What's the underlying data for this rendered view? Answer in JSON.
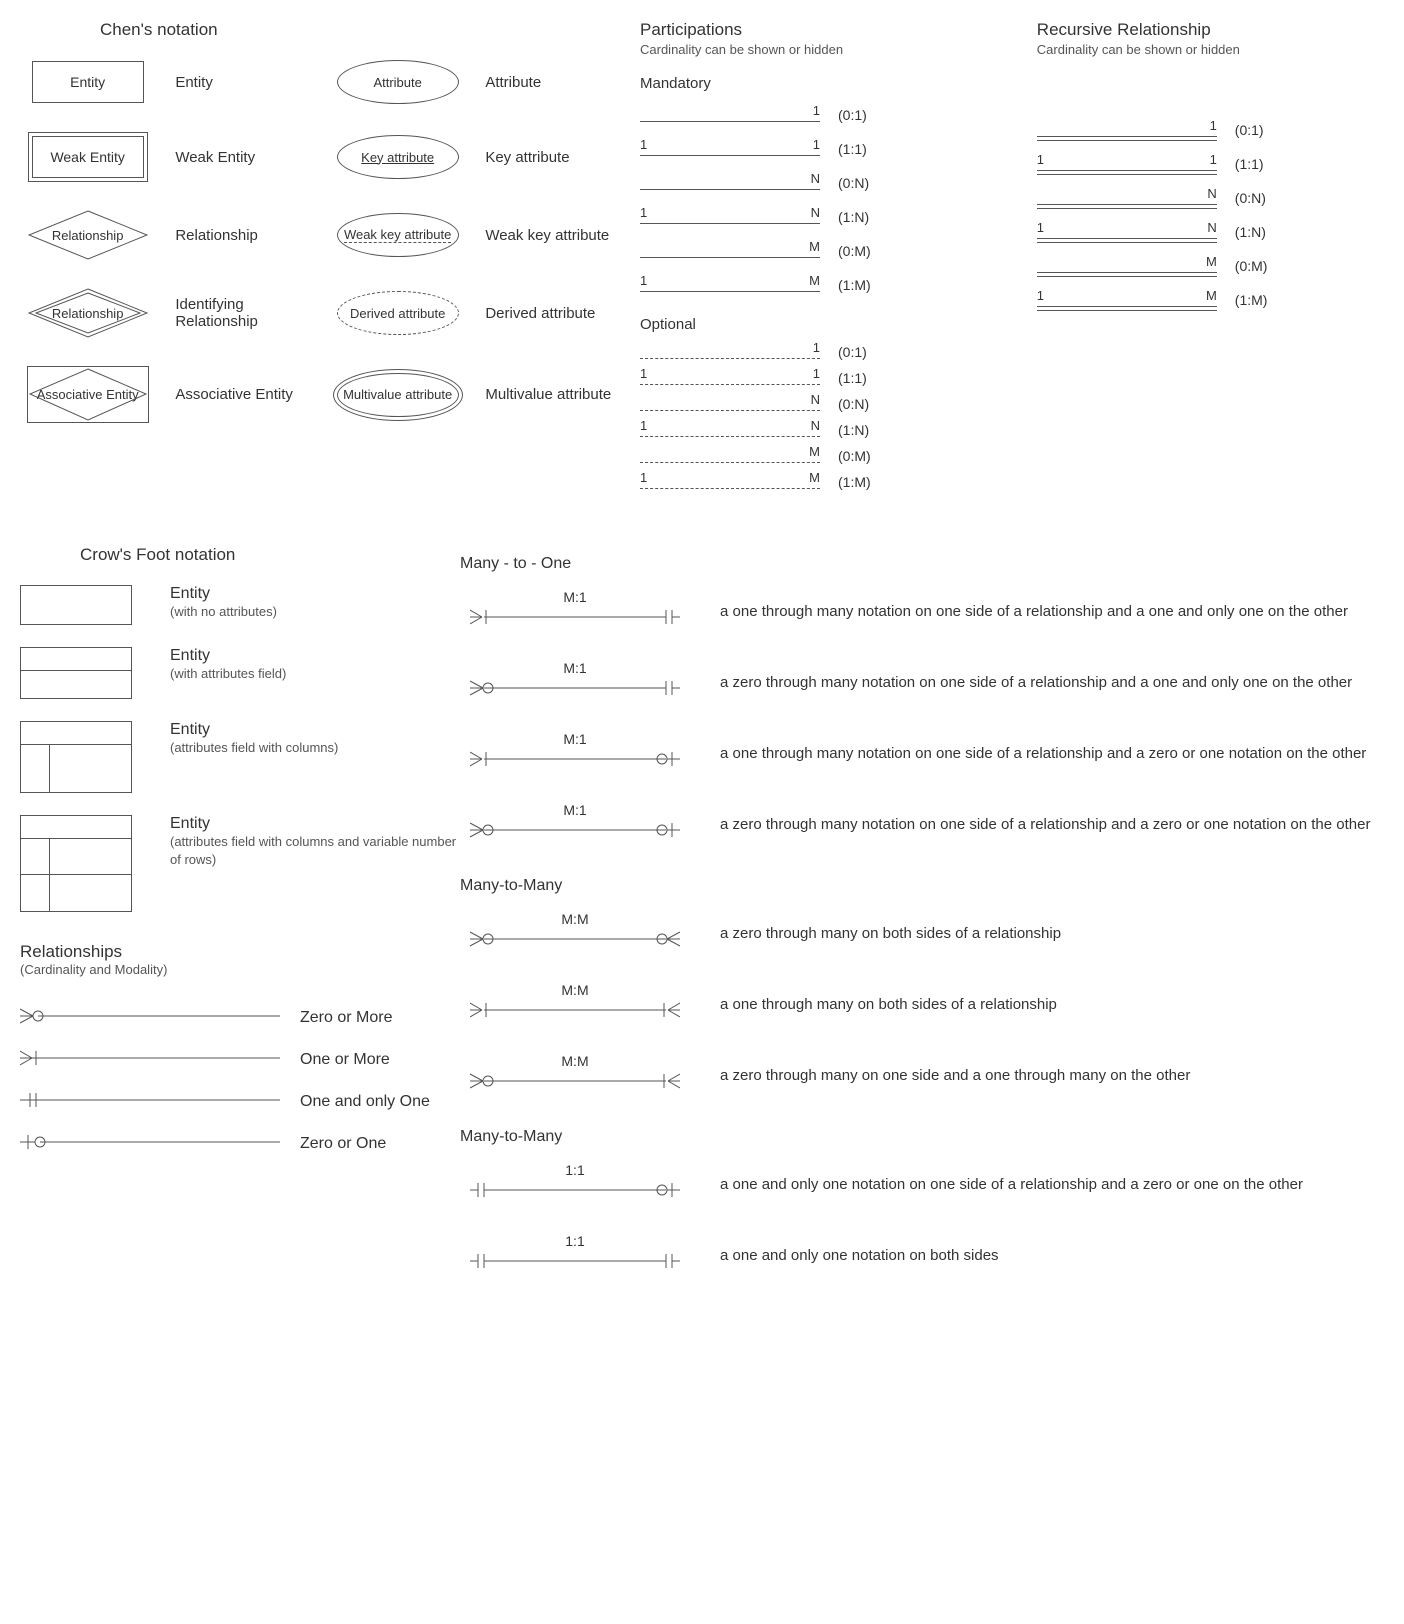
{
  "chen": {
    "title": "Chen's notation",
    "entity": {
      "shape_text": "Entity",
      "label": "Entity"
    },
    "weak_entity": {
      "shape_text": "Weak Entity",
      "label": "Weak Entity"
    },
    "relationship": {
      "shape_text": "Relationship",
      "label": "Relationship"
    },
    "ident_relationship": {
      "shape_text": "Relationship",
      "label": "Identifying Relationship"
    },
    "assoc_entity": {
      "shape_text": "Associative Entity",
      "label": "Associative Entity"
    },
    "attribute": {
      "shape_text": "Attribute",
      "label": "Attribute"
    },
    "key_attribute": {
      "shape_text": "Key attribute",
      "label": "Key attribute"
    },
    "weak_key_attribute": {
      "shape_text": "Weak key attribute",
      "label": "Weak key attribute"
    },
    "derived_attribute": {
      "shape_text": "Derived attribute",
      "label": "Derived attribute"
    },
    "multivalue_attribute": {
      "shape_text": "Multivalue attribute",
      "label": "Multivalue attribute"
    }
  },
  "participations": {
    "title": "Participations",
    "subtitle": "Cardinality can be shown or hidden",
    "mandatory_title": "Mandatory",
    "optional_title": "Optional",
    "mandatory": [
      {
        "left": "",
        "right": "1",
        "label": "(0:1)"
      },
      {
        "left": "1",
        "right": "1",
        "label": "(1:1)"
      },
      {
        "left": "",
        "right": "N",
        "label": "(0:N)"
      },
      {
        "left": "1",
        "right": "N",
        "label": "(1:N)"
      },
      {
        "left": "",
        "right": "M",
        "label": "(0:M)"
      },
      {
        "left": "1",
        "right": "M",
        "label": "(1:M)"
      }
    ],
    "optional": [
      {
        "left": "",
        "right": "1",
        "label": "(0:1)"
      },
      {
        "left": "1",
        "right": "1",
        "label": "(1:1)"
      },
      {
        "left": "",
        "right": "N",
        "label": "(0:N)"
      },
      {
        "left": "1",
        "right": "N",
        "label": "(1:N)"
      },
      {
        "left": "",
        "right": "M",
        "label": "(0:M)"
      },
      {
        "left": "1",
        "right": "M",
        "label": "(1:M)"
      }
    ]
  },
  "recursive": {
    "title": "Recursive Relationship",
    "subtitle": "Cardinality can be shown or hidden",
    "rows": [
      {
        "left": "",
        "right": "1",
        "label": "(0:1)"
      },
      {
        "left": "1",
        "right": "1",
        "label": "(1:1)"
      },
      {
        "left": "",
        "right": "N",
        "label": "(0:N)"
      },
      {
        "left": "1",
        "right": "N",
        "label": "(1:N)"
      },
      {
        "left": "",
        "right": "M",
        "label": "(0:M)"
      },
      {
        "left": "1",
        "right": "M",
        "label": "(1:M)"
      }
    ]
  },
  "crowsfoot": {
    "title": "Crow's Foot notation",
    "entities": [
      {
        "label": "Entity",
        "sub": "(with no attributes)"
      },
      {
        "label": "Entity",
        "sub": "(with attributes field)"
      },
      {
        "label": "Entity",
        "sub": "(attributes field with columns)"
      },
      {
        "label": "Entity",
        "sub": "(attributes field with columns and variable number of rows)"
      }
    ],
    "relationships_title": "Relationships",
    "relationships_sub": "(Cardinality and Modality)",
    "relationships": [
      {
        "label": "Zero or More"
      },
      {
        "label": "One or More"
      },
      {
        "label": "One and only One"
      },
      {
        "label": "Zero or One"
      }
    ],
    "many_to_one_title": "Many - to - One",
    "many_to_one": [
      {
        "ratio": "M:1",
        "desc": "a one through many notation on one side of a relationship and a one and only one on the other"
      },
      {
        "ratio": "M:1",
        "desc": "a zero through many notation on one side of a relationship and a one and only one on the other"
      },
      {
        "ratio": "M:1",
        "desc": "a one through many notation on one side of a relationship and a zero or one notation on the other"
      },
      {
        "ratio": "M:1",
        "desc": "a zero through many notation on one side of a relationship and a zero or one notation on the other"
      }
    ],
    "many_to_many_title": "Many-to-Many",
    "many_to_many": [
      {
        "ratio": "M:M",
        "desc": "a zero through many on both sides of a relationship"
      },
      {
        "ratio": "M:M",
        "desc": "a one through many on both sides of a relationship"
      },
      {
        "ratio": "M:M",
        "desc": "a zero through many on one side and a one through many on the other"
      }
    ],
    "one_to_one_title": "Many-to-Many",
    "one_to_one": [
      {
        "ratio": "1:1",
        "desc": "a one and only one notation on one side of a relationship and a zero or one on the other"
      },
      {
        "ratio": "1:1",
        "desc": "a one and only one notation on both sides"
      }
    ]
  }
}
